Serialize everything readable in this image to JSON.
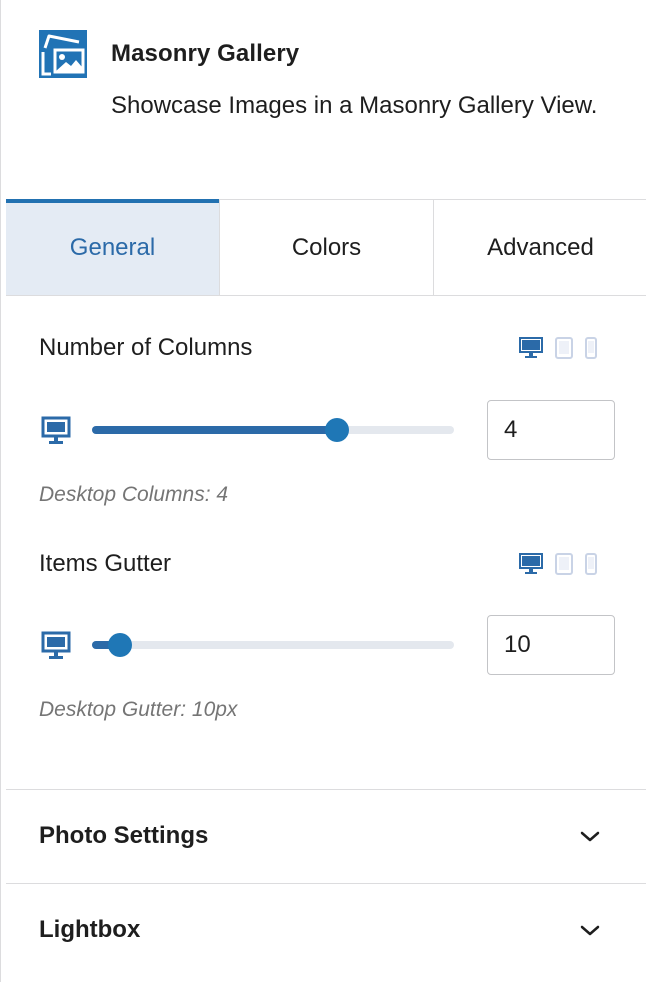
{
  "block": {
    "icon": "gallery-image-icon",
    "title": "Masonry Gallery",
    "description": "Showcase Images in a Masonry Gallery View."
  },
  "tabs": [
    {
      "label": "General",
      "active": true
    },
    {
      "label": "Colors",
      "active": false
    },
    {
      "label": "Advanced",
      "active": false
    }
  ],
  "controls": {
    "columns": {
      "label": "Number of Columns",
      "value": "4",
      "min": 1,
      "max": 5,
      "help": "Desktop Columns: 4",
      "devices": [
        "desktop-icon",
        "tablet-icon",
        "mobile-icon"
      ]
    },
    "gutter": {
      "label": "Items Gutter",
      "value": "10",
      "min": 0,
      "max": 200,
      "help": "Desktop Gutter: 10px",
      "devices": [
        "desktop-icon",
        "tablet-icon",
        "mobile-icon"
      ]
    }
  },
  "sections": [
    {
      "title": "Photo Settings",
      "icon": "chevron-down-icon"
    },
    {
      "title": "Lightbox",
      "icon": "chevron-down-icon"
    }
  ],
  "colors": {
    "accent": "#2271b1",
    "tab_active_bg": "#e4ebf4",
    "slider_fill": "#2b6aa8",
    "slider_thumb": "#1f77b6",
    "icon_active": "#2b6aa8",
    "icon_inactive": "#c9d3e6"
  }
}
